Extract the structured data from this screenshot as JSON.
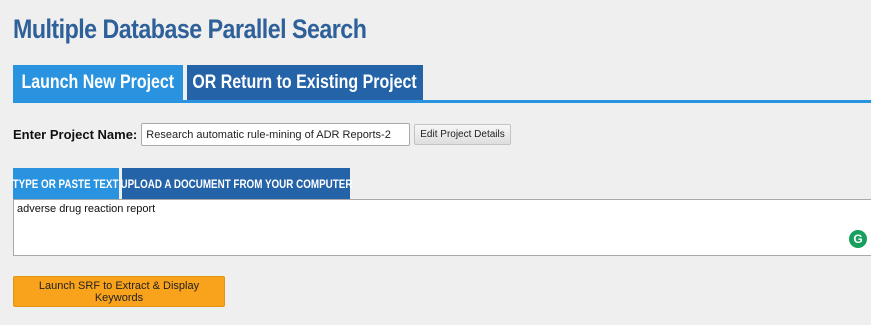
{
  "page": {
    "title": "Multiple Database Parallel Search"
  },
  "main_tabs": [
    {
      "label": "Launch New Project",
      "active": true
    },
    {
      "label": "OR Return to Existing Project",
      "active": false
    }
  ],
  "project": {
    "label": "Enter Project Name:",
    "name_value": "Research automatic rule-mining of ADR Reports-2",
    "edit_button": "Edit Project Details"
  },
  "input_tabs": [
    {
      "label": "TYPE OR PASTE TEXT",
      "active": true
    },
    {
      "label": "UPLOAD A DOCUMENT FROM YOUR COMPUTER",
      "active": false
    }
  ],
  "text_input": {
    "value": "adverse drug reaction report"
  },
  "grammarly": {
    "icon": "grammarly-icon",
    "glyph": "G",
    "color": "#17a05d"
  },
  "launch_button": {
    "label": "Launch SRF to Extract & Display Keywords"
  },
  "colors": {
    "title": "#2e6099",
    "tab_active": "#2a93e0",
    "tab_inactive": "#2563a8",
    "launch_button": "#f9a21c"
  }
}
